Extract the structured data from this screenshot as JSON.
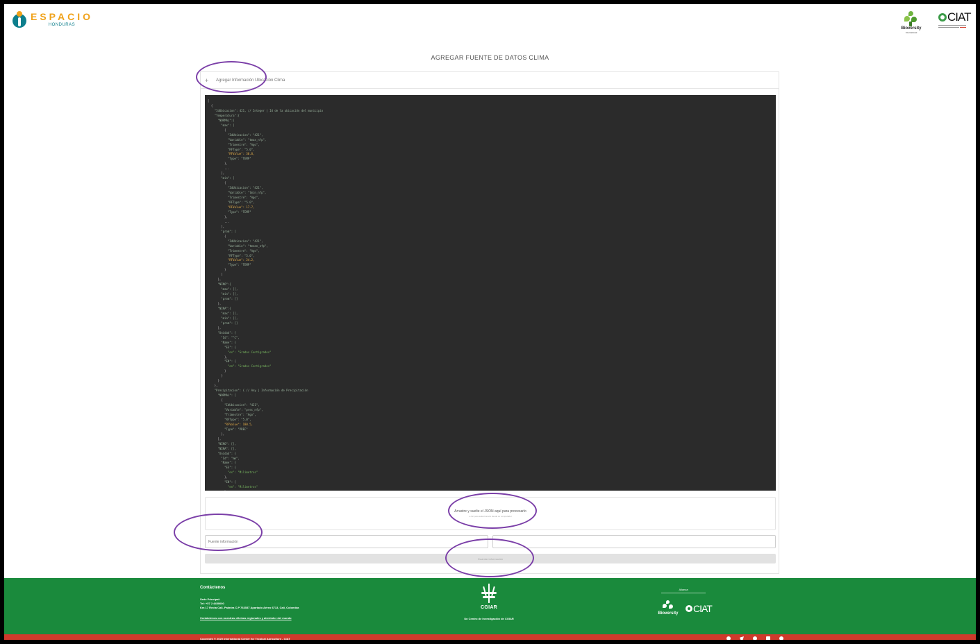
{
  "header": {
    "brand_name": "ESPACIO",
    "brand_sub": "HONDURAS",
    "partner1_name": "Bioversity",
    "partner1_sub": "International",
    "partner2_name": "CIAT"
  },
  "page": {
    "title": "AGREGAR FUENTE DE DATOS CLIMA"
  },
  "accordion": {
    "label": "Agregar Información Ubicación Clima"
  },
  "code": {
    "lines": [
      {
        "t": "[",
        "c": "c"
      },
      {
        "t": "  {",
        "c": "c"
      },
      {
        "t": "    \"IdUbicacion\": 421, // Integer | Id de la ubicación del municipio",
        "c": "k"
      },
      {
        "t": "    \"Temperatura\":{",
        "c": "k"
      },
      {
        "t": "      \"NORMAL\":{",
        "c": "k"
      },
      {
        "t": "        \"max\": [",
        "c": "k"
      },
      {
        "t": "          {",
        "c": "c"
      },
      {
        "t": "            \"IdUbicacion\": \"421\",",
        "c": "k"
      },
      {
        "t": "            \"Variable\": \"tmax_nfp\",",
        "c": "k"
      },
      {
        "t": "            \"Trimestre\": \"Ago\",",
        "c": "k"
      },
      {
        "t": "            \"RFType\": \"5.0\",",
        "c": "k"
      },
      {
        "t": "            \"RFValue\": 30.8,",
        "c": "n"
      },
      {
        "t": "            \"Type\": \"TEMP\"",
        "c": "k"
      },
      {
        "t": "          },",
        "c": "c"
      },
      {
        "t": "          ...",
        "c": "c"
      },
      {
        "t": "        ],",
        "c": "c"
      },
      {
        "t": "        \"min\": [",
        "c": "k"
      },
      {
        "t": "          {",
        "c": "c"
      },
      {
        "t": "            \"IdUbicacion\": \"421\",",
        "c": "k"
      },
      {
        "t": "            \"Variable\": \"tmin_nfp\",",
        "c": "k"
      },
      {
        "t": "            \"Trimestre\": \"Ago\",",
        "c": "k"
      },
      {
        "t": "            \"RFType\": \"5.0\",",
        "c": "k"
      },
      {
        "t": "            \"RFValue\": 17.7,",
        "c": "n"
      },
      {
        "t": "            \"Type\": \"TEMP\"",
        "c": "k"
      },
      {
        "t": "          },",
        "c": "c"
      },
      {
        "t": "          ...",
        "c": "c"
      },
      {
        "t": "        ],",
        "c": "c"
      },
      {
        "t": "        \"prom\": [",
        "c": "k"
      },
      {
        "t": "          {",
        "c": "c"
      },
      {
        "t": "            \"IdUbicacion\": \"421\",",
        "c": "k"
      },
      {
        "t": "            \"Variable\": \"tmean_nfp\",",
        "c": "k"
      },
      {
        "t": "            \"Trimestre\": \"Ago\",",
        "c": "k"
      },
      {
        "t": "            \"RFType\": \"5.0\",",
        "c": "k"
      },
      {
        "t": "            \"RFValue\": 24.2,",
        "c": "n"
      },
      {
        "t": "            \"Type\": \"TEMP\"",
        "c": "k"
      },
      {
        "t": "          }",
        "c": "c"
      },
      {
        "t": "        ]",
        "c": "c"
      },
      {
        "t": "      },",
        "c": "c"
      },
      {
        "t": "      \"NINO\":{",
        "c": "k"
      },
      {
        "t": "        \"max\": [],",
        "c": "k"
      },
      {
        "t": "        \"min\": [],",
        "c": "k"
      },
      {
        "t": "        \"prom\": []",
        "c": "k"
      },
      {
        "t": "      },",
        "c": "c"
      },
      {
        "t": "      \"NINA\":{",
        "c": "k"
      },
      {
        "t": "        \"max\": [],",
        "c": "k"
      },
      {
        "t": "        \"min\": [],",
        "c": "k"
      },
      {
        "t": "        \"prom\": []",
        "c": "k"
      },
      {
        "t": "      },",
        "c": "c"
      },
      {
        "t": "      \"Unidad\": {",
        "c": "k"
      },
      {
        "t": "        \"Id\": \"°C\",",
        "c": "k"
      },
      {
        "t": "        \"Name\": {",
        "c": "k"
      },
      {
        "t": "          \"ES\": {",
        "c": "k"
      },
      {
        "t": "            \"es\": \"Grados Centígrados\"",
        "c": "g"
      },
      {
        "t": "          },",
        "c": "c"
      },
      {
        "t": "          \"EN\": {",
        "c": "k"
      },
      {
        "t": "            \"en\": \"Grados Centígrados\"",
        "c": "g"
      },
      {
        "t": "          }",
        "c": "c"
      },
      {
        "t": "        }",
        "c": "c"
      },
      {
        "t": "      }",
        "c": "c"
      },
      {
        "t": "    },",
        "c": "c"
      },
      {
        "t": "    \"Precipitacion\": { // Any | Información de Precipitación",
        "c": "k"
      },
      {
        "t": "      \"NORMAL\": [",
        "c": "k"
      },
      {
        "t": "        {",
        "c": "c"
      },
      {
        "t": "          \"IdUbicacion\": \"421\",",
        "c": "k"
      },
      {
        "t": "          \"Variable\": \"prec_nfp\",",
        "c": "k"
      },
      {
        "t": "          \"Trimestre\": \"Ago\",",
        "c": "k"
      },
      {
        "t": "          \"RFType\": \"5.0\",",
        "c": "k"
      },
      {
        "t": "          \"RFValue\": 180.5,",
        "c": "n"
      },
      {
        "t": "          \"Type\": \"PREC\"",
        "c": "k"
      },
      {
        "t": "        },",
        "c": "c"
      },
      {
        "t": "      ],",
        "c": "c"
      },
      {
        "t": "      \"NINO\": [],",
        "c": "k"
      },
      {
        "t": "      \"NINA\": [],",
        "c": "k"
      },
      {
        "t": "      \"Unidad\": {",
        "c": "k"
      },
      {
        "t": "        \"Id\": \"mm\",",
        "c": "k"
      },
      {
        "t": "        \"Name\": {",
        "c": "k"
      },
      {
        "t": "          \"ES\": {",
        "c": "k"
      },
      {
        "t": "            \"es\": \"Milímetros\"",
        "c": "g"
      },
      {
        "t": "          },",
        "c": "c"
      },
      {
        "t": "          \"EN\": {",
        "c": "k"
      },
      {
        "t": "            \"en\": \"Milímetros\"",
        "c": "g"
      },
      {
        "t": "          }",
        "c": "c"
      },
      {
        "t": "        }",
        "c": "c"
      },
      {
        "t": "      },",
        "c": "c"
      },
      {
        "t": "    },",
        "c": "c"
      },
      {
        "t": "  },",
        "c": "c"
      },
      {
        "t": "  ... //Se pueden agregar uno o muchos a la vez",
        "c": "c"
      },
      {
        "t": "]",
        "c": "c"
      }
    ]
  },
  "dropzone": {
    "title": "Arrastre y suelte el JSON aquí para procesarlo",
    "hint": "o clic para seleccionarlo desde su computador"
  },
  "form": {
    "source_placeholder": "Fuente información",
    "date_placeholder": "",
    "submit_label": "Guardar información"
  },
  "footer": {
    "contact_title": "Contáctenos",
    "contact_lines": [
      "Sede Principal:",
      "Tel: +57 2 4450000",
      "Km 17 Recta Cali- Palmira C.P 763537 Apartado Aéreo 6713, Cali, Colombia"
    ],
    "contact_link": "Contáctenos con nuestras oficinas regionales y alrededor del mundo",
    "cgiar_name": "CGIAR",
    "cgiar_sub": "Un Centro de Investigación de CGIAR",
    "alianza": "Alianza",
    "alliance_partner1": "Bioversity",
    "alliance_partner2": "CIAT",
    "copyright": "Copyright © 2020 International Center for Tropical Agriculture - CIAT"
  },
  "colors": {
    "footer_green": "#1a8a3c",
    "footer_red": "#cf3a2c",
    "code_bg": "#2b2b2b",
    "annotation_purple": "#7b3fa8",
    "brand_orange": "#f0a21a",
    "brand_teal": "#0d7f8d"
  },
  "icons": [
    "plus-icon",
    "facebook-icon",
    "twitter-icon",
    "instagram-icon",
    "youtube-icon",
    "flickr-icon"
  ]
}
